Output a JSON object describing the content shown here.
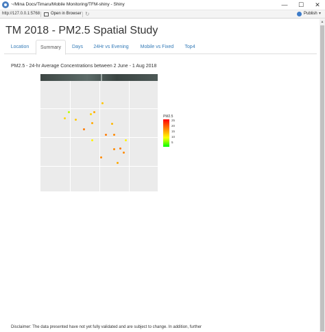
{
  "window": {
    "title": "~/Mina Docs/Timaru/Mobile Monitoring/TFM-shiny - Shiny",
    "minimize": "—",
    "maximize": "☐",
    "close": "✕"
  },
  "toolbar": {
    "url": "http://127.0.0.1:5768",
    "open_browser": "Open in Browser",
    "refresh": "↻",
    "publish": "Publish",
    "publish_caret": "▾"
  },
  "page": {
    "title": "TM 2018 - PM2.5 Spatial Study",
    "tabs": [
      {
        "label": "Location",
        "active": false
      },
      {
        "label": "Summary",
        "active": true
      },
      {
        "label": "Days",
        "active": false
      },
      {
        "label": "24Hr vs Evening",
        "active": false
      },
      {
        "label": "Mobile vs Fixed",
        "active": false
      },
      {
        "label": "Top4",
        "active": false
      }
    ],
    "plot_heading": "PM2.5 - 24-hr Average Concentrations between 2 June - 1 Aug 2018",
    "disclaimer": "Disclaimer: The data presented have not yet fully validated and are subject to change. In addition, further"
  },
  "chart_data": {
    "type": "scatter",
    "title": "",
    "xlabel": "",
    "ylabel": "",
    "legend": {
      "title": "PM2.5",
      "ticks": [
        25,
        20,
        15,
        10,
        5
      ],
      "range": [
        0,
        25
      ],
      "colors": [
        "#00ff00",
        "#ffff00",
        "#ff8000",
        "#ff0000"
      ],
      "placement": "right"
    },
    "grid": true,
    "points": [
      {
        "x": 0.53,
        "y": 0.8,
        "value": 12
      },
      {
        "x": 0.24,
        "y": 0.72,
        "value": 6
      },
      {
        "x": 0.46,
        "y": 0.72,
        "value": 14
      },
      {
        "x": 0.43,
        "y": 0.7,
        "value": 11
      },
      {
        "x": 0.21,
        "y": 0.66,
        "value": 11
      },
      {
        "x": 0.3,
        "y": 0.65,
        "value": 12
      },
      {
        "x": 0.44,
        "y": 0.62,
        "value": 14
      },
      {
        "x": 0.61,
        "y": 0.61,
        "value": 13
      },
      {
        "x": 0.37,
        "y": 0.56,
        "value": 17
      },
      {
        "x": 0.56,
        "y": 0.51,
        "value": 17
      },
      {
        "x": 0.63,
        "y": 0.51,
        "value": 16
      },
      {
        "x": 0.44,
        "y": 0.46,
        "value": 9
      },
      {
        "x": 0.73,
        "y": 0.46,
        "value": 9
      },
      {
        "x": 0.68,
        "y": 0.39,
        "value": 17
      },
      {
        "x": 0.63,
        "y": 0.38,
        "value": 16
      },
      {
        "x": 0.71,
        "y": 0.35,
        "value": 16
      },
      {
        "x": 0.52,
        "y": 0.31,
        "value": 16
      },
      {
        "x": 0.66,
        "y": 0.26,
        "value": 14
      }
    ]
  }
}
